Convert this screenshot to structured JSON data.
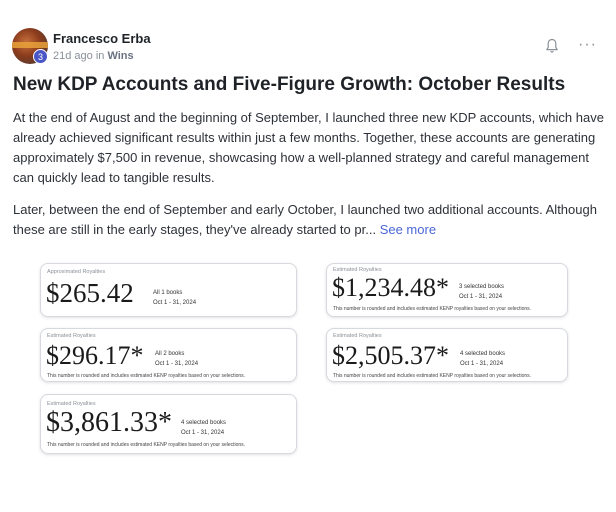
{
  "post": {
    "author": "Francesco Erba",
    "level": "3",
    "time_ago": "21d ago in",
    "category": "Wins",
    "title": "New KDP Accounts and Five-Figure Growth: October Results",
    "paragraph1": "At the end of August and the beginning of September, I launched three new KDP accounts, which have already achieved significant results within just a few months. Together, these accounts are generating approximately $7,500 in revenue, showcasing how a well-planned strategy and careful management can quickly lead to tangible results.",
    "paragraph2": "Later, between the end of September and early October, I launched two additional accounts. Although these are still in the early stages, they've already started to pr...",
    "see_more": "See more",
    "more_menu": "···"
  },
  "cards": [
    {
      "label": "Approximated Royalties",
      "amount": "$265.42",
      "books": "All 1 books",
      "range": "Oct 1 - 31, 2024",
      "note": ""
    },
    {
      "label": "Estimated Royalties",
      "amount": "$1,234.48*",
      "books": "3 selected books",
      "range": "Oct 1 - 31, 2024",
      "note": "This number is rounded and includes estimated KENP royalties based on your selections."
    },
    {
      "label": "Estimated Royalties",
      "amount": "$296.17*",
      "books": "All 2 books",
      "range": "Oct 1 - 31, 2024",
      "note": "This number is rounded and includes estimated KENP royalties based on your selections."
    },
    {
      "label": "Estimated Royalties",
      "amount": "$2,505.37*",
      "books": "4 selected books",
      "range": "Oct 1 - 31, 2024",
      "note": "This number is rounded and includes estimated KENP royalties based on your selections."
    },
    {
      "label": "Estimated Royalties",
      "amount": "$3,861.33*",
      "books": "4 selected books",
      "range": "Oct 1 - 31, 2024",
      "note": "This number is rounded and includes estimated KENP royalties based on your selections."
    }
  ],
  "icons": {
    "bell": "bell-icon",
    "more": "more-icon"
  },
  "colors": {
    "link": "#4a67d6",
    "badge": "#4a56c5"
  }
}
